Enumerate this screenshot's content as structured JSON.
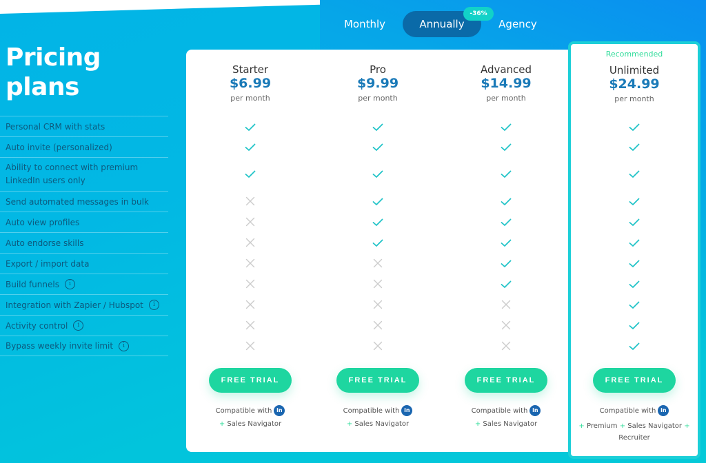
{
  "billing_tabs": [
    {
      "label": "Monthly",
      "active": false
    },
    {
      "label": "Annually",
      "active": true,
      "badge": "-36%"
    },
    {
      "label": "Agency",
      "active": false
    }
  ],
  "page_title_line1": "Pricing",
  "page_title_line2": "plans",
  "features": [
    {
      "label": "Personal CRM with stats",
      "info": false
    },
    {
      "label": "Auto invite (personalized)",
      "info": false
    },
    {
      "label": "Ability to connect with premium LinkedIn users only",
      "info": false
    },
    {
      "label": "Send automated messages in bulk",
      "info": false
    },
    {
      "label": "Auto view profiles",
      "info": false
    },
    {
      "label": "Auto endorse skills",
      "info": false
    },
    {
      "label": "Export / import data",
      "info": false
    },
    {
      "label": "Build funnels",
      "info": true
    },
    {
      "label": "Integration with Zapier / Hubspot",
      "info": true
    },
    {
      "label": "Activity control",
      "info": true
    },
    {
      "label": "Bypass weekly invite limit",
      "info": true
    }
  ],
  "info_glyph": "i",
  "plans": [
    {
      "name": "Starter",
      "price": "$6.99",
      "period": "per month",
      "features": [
        true,
        true,
        true,
        false,
        false,
        false,
        false,
        false,
        false,
        false,
        false
      ],
      "cta": "FREE TRIAL",
      "compat_text": "Compatible with",
      "compat_extra": "Sales Navigator"
    },
    {
      "name": "Pro",
      "price": "$9.99",
      "period": "per month",
      "features": [
        true,
        true,
        true,
        true,
        true,
        true,
        false,
        false,
        false,
        false,
        false
      ],
      "cta": "FREE TRIAL",
      "compat_text": "Compatible with",
      "compat_extra": "Sales Navigator"
    },
    {
      "name": "Advanced",
      "price": "$14.99",
      "period": "per month",
      "features": [
        true,
        true,
        true,
        true,
        true,
        true,
        true,
        true,
        false,
        false,
        false
      ],
      "cta": "FREE TRIAL",
      "compat_text": "Compatible with",
      "compat_extra": "Sales Navigator"
    },
    {
      "name": "Unlimited",
      "price": "$24.99",
      "period": "per month",
      "recommended": "Recommended",
      "features": [
        true,
        true,
        true,
        true,
        true,
        true,
        true,
        true,
        true,
        true,
        true
      ],
      "cta": "FREE TRIAL",
      "compat_text": "Compatible with",
      "compat_extra_items": [
        "Premium",
        "Sales Navigator",
        "Recruiter"
      ]
    }
  ],
  "linkedin_badge": "in",
  "plus_glyph": "+",
  "colors": {
    "check": "#22c4c8",
    "cross": "#cccccc",
    "cta": "#1ed6a0",
    "price": "#1a7ab8",
    "recommended": "#2fdc9a",
    "active_tab": "#0a6aa8"
  }
}
